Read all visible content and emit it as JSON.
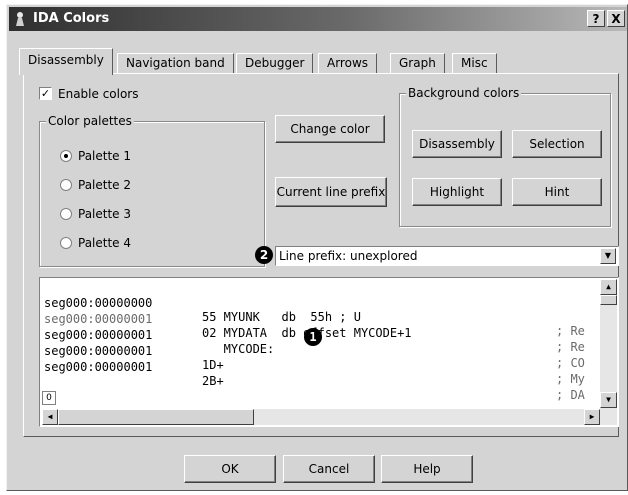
{
  "window": {
    "title": "IDA Colors",
    "help_btn": "?",
    "close_btn": "X"
  },
  "tabs": [
    {
      "label": "Disassembly",
      "active": true
    },
    {
      "label": "Navigation band",
      "active": false
    },
    {
      "label": "Debugger",
      "active": false
    },
    {
      "label": "Arrows",
      "active": false
    },
    {
      "label": "Graph",
      "active": false
    },
    {
      "label": "Misc",
      "active": false
    }
  ],
  "enable_colors": {
    "label": "Enable colors",
    "checked": true,
    "check_glyph": "✓"
  },
  "palettes": {
    "title": "Color palettes",
    "options": [
      {
        "label": "Palette 1",
        "checked": true
      },
      {
        "label": "Palette 2",
        "checked": false
      },
      {
        "label": "Palette 3",
        "checked": false
      },
      {
        "label": "Palette 4",
        "checked": false
      }
    ]
  },
  "buttons": {
    "change_color": "Change color",
    "current_line_prefix": "Current line prefix"
  },
  "background": {
    "title": "Background colors",
    "disassembly": "Disassembly",
    "selection": "Selection",
    "highlight": "Highlight",
    "hint": "Hint"
  },
  "markers": {
    "one": "1",
    "two": "2"
  },
  "item_select": {
    "value": "Line prefix: unexplored",
    "arrow": "▼"
  },
  "code_lines": [
    {
      "addr": "seg000:00000000",
      "text": "55 MYUNK   db  55h ; U",
      "comment": "; Re"
    },
    {
      "addr": "seg000:00000001",
      "text": "02 MYDATA  db offset MYCODE+1",
      "comment": "; Re"
    },
    {
      "addr": "seg000:00000001",
      "text": "   MYCODE:",
      "comment": "; CO"
    },
    {
      "addr": "seg000:00000001",
      "text": "1D+",
      "comment": "; My"
    },
    {
      "addr": "seg000:00000001",
      "text": "2B+",
      "comment": "; DA"
    }
  ],
  "code_scroll": {
    "position": "0",
    "up": "▲",
    "down": "▼",
    "left": "◀",
    "right": "▶"
  },
  "dialog_buttons": {
    "ok": "OK",
    "cancel": "Cancel",
    "help": "Help"
  }
}
